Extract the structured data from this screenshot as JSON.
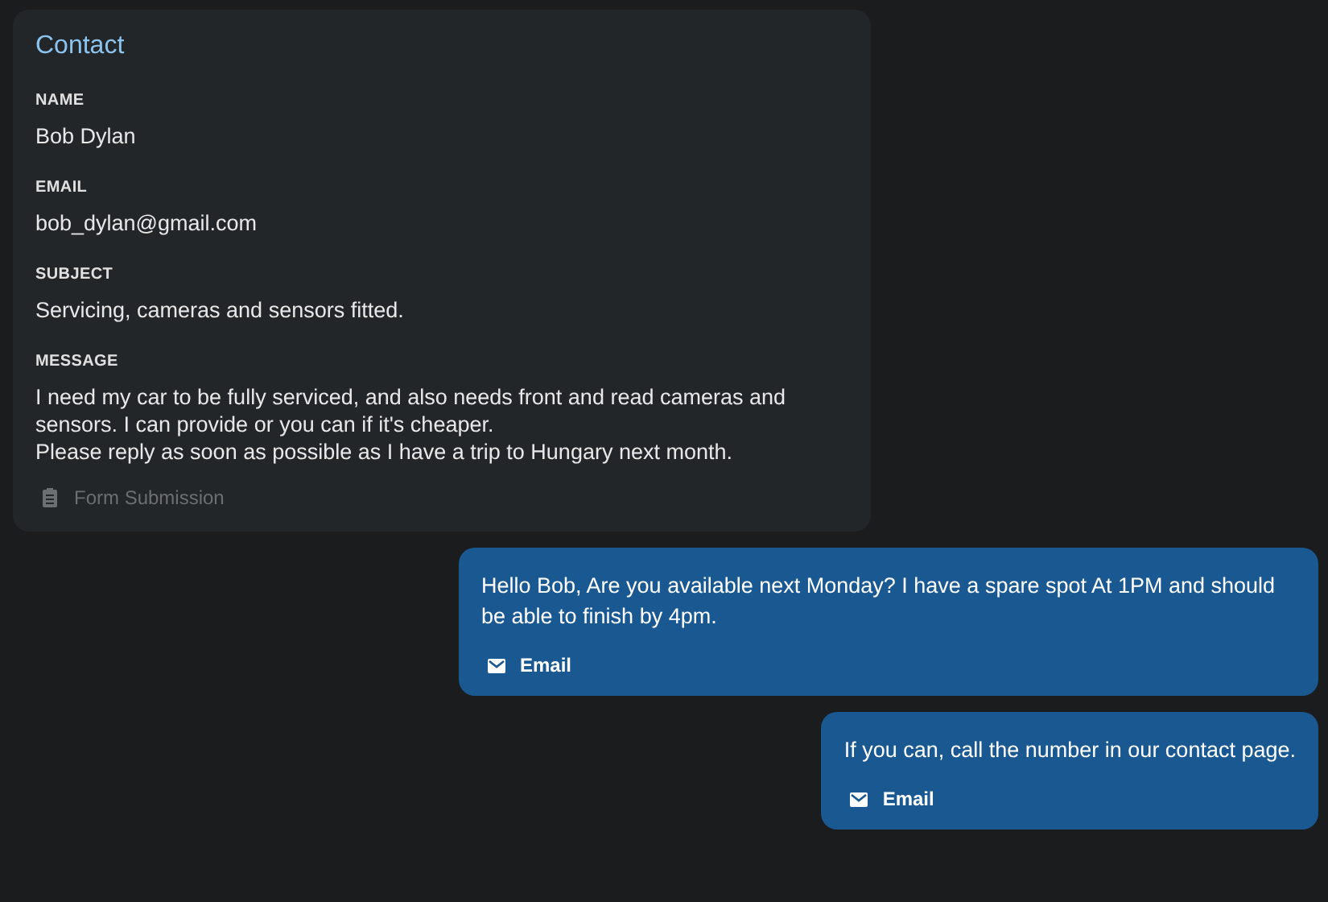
{
  "contact": {
    "title": "Contact",
    "fields": [
      {
        "label": "NAME",
        "value": "Bob Dylan"
      },
      {
        "label": "EMAIL",
        "value": "bob_dylan@gmail.com"
      },
      {
        "label": "SUBJECT",
        "value": "Servicing, cameras and sensors fitted."
      },
      {
        "label": "MESSAGE",
        "value": "I need my car to be fully serviced, and also needs front and read cameras and sensors. I can provide or you can if it's cheaper.\nPlease reply as soon as possible as I have a trip to Hungary next month."
      }
    ],
    "source": "Form Submission"
  },
  "replies": [
    {
      "text": "Hello Bob, Are you available next Monday? I have a spare spot At 1PM and should be able to finish by 4pm.",
      "channel": "Email"
    },
    {
      "text": "If you can, call the number in our contact page.",
      "channel": "Email"
    }
  ]
}
